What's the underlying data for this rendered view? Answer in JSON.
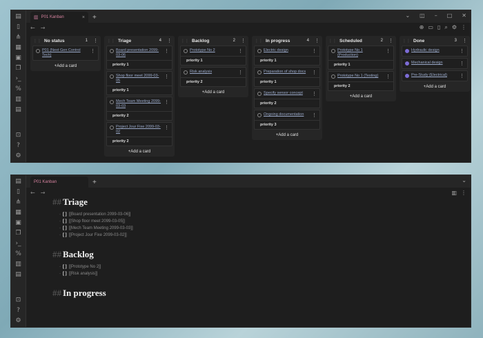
{
  "top": {
    "tab": {
      "icon": "kanban-icon",
      "label": "P01 Kanban",
      "close": "×"
    },
    "new_tab": "+",
    "nav": {
      "back": "←",
      "forward": "→"
    },
    "lanes": [
      {
        "title": "No status",
        "count": "1",
        "cards": [
          {
            "title": "P01 (Next Gen Control Tech)",
            "done": false,
            "priority": ""
          }
        ],
        "add": "+Add a card"
      },
      {
        "title": "Triage",
        "count": "4",
        "cards": [
          {
            "title": "Board presentation 2099-03-06",
            "done": false,
            "priority": "priority   1"
          },
          {
            "title": "Shop floor meet 2099-03-05",
            "done": false,
            "priority": "priority   1"
          },
          {
            "title": "Mech Team Meeting 2099-03-03",
            "done": false,
            "priority": "priority   2"
          },
          {
            "title": "Project Jour Fixe 2099-03-02",
            "done": false,
            "priority": "priority   2"
          }
        ],
        "add": "+Add a card"
      },
      {
        "title": "Backlog",
        "count": "2",
        "cards": [
          {
            "title": "Prototype No 2",
            "done": false,
            "priority": "priority   1"
          },
          {
            "title": "Risk analysis",
            "done": false,
            "priority": "priority   2"
          }
        ],
        "add": "+Add a card"
      },
      {
        "title": "In progress",
        "count": "4",
        "cards": [
          {
            "title": "Electric design",
            "done": false,
            "priority": "priority   1"
          },
          {
            "title": "Preparation of shop docs",
            "done": false,
            "priority": "priority   1"
          },
          {
            "title": "Specify sensor concept",
            "done": false,
            "priority": "priority   2"
          },
          {
            "title": "Ongoing documentation",
            "done": false,
            "priority": "priority   3"
          }
        ],
        "add": "+Add a card"
      },
      {
        "title": "Scheduled",
        "count": "2",
        "cards": [
          {
            "title": "Prototype No 1 (Production)",
            "done": false,
            "priority": "priority   1"
          },
          {
            "title": "Prototype No 1 (Testing)",
            "done": false,
            "priority": "priority   2"
          }
        ],
        "add": "+Add a card"
      },
      {
        "title": "Done",
        "count": "3",
        "cards": [
          {
            "title": "Hydraulic design",
            "done": true,
            "priority": ""
          },
          {
            "title": "Mechanical design",
            "done": true,
            "priority": ""
          },
          {
            "title": "Pre-Study (Electrical)",
            "done": true,
            "priority": ""
          }
        ],
        "add": "+Add a card"
      }
    ]
  },
  "bottom": {
    "tab": {
      "label": "P01 Kanban"
    },
    "new_tab": "+",
    "sections": [
      {
        "hash": "##",
        "title": "Triage",
        "tasks": [
          "[[Board presentation 2099-03-06]]",
          "[[Shop floor meet 2099-03-05]]",
          "[[Mech Team Meeting 2099-03-03]]",
          "[[Project Jour Fixe 2099-03-02]]"
        ]
      },
      {
        "hash": "##",
        "title": "Backlog",
        "tasks": [
          "[[Prototype No 2]]",
          "[[Risk analysis]]"
        ]
      },
      {
        "hash": "##",
        "title": "In progress",
        "tasks": []
      }
    ],
    "checkbox": "[ ]",
    "bullet": "-"
  },
  "colors": {
    "accent_tab": "#d6839f",
    "done_check": "#7c6cd6",
    "link": "#9aa9c9"
  }
}
